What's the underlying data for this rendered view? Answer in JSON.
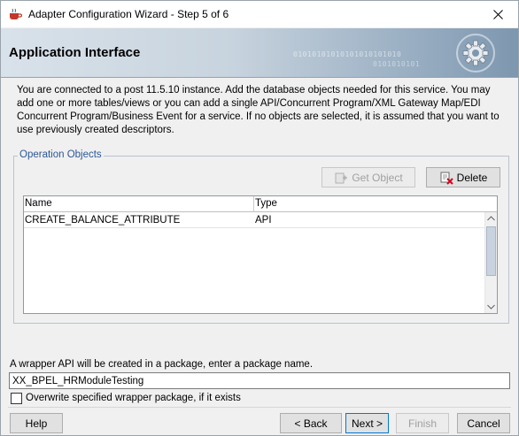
{
  "window": {
    "title": "Adapter Configuration Wizard - Step 5 of 6"
  },
  "header": {
    "title": "Application Interface",
    "binary_line1": "01010101010101010101010",
    "binary_line2": "0101010101"
  },
  "description": "You are connected to a post 11.5.10 instance. Add the database objects needed for this service. You may add one or more tables/views or you can add a single API/Concurrent Program/XML Gateway Map/EDI Concurrent Program/Business Event for a service. If no objects are selected, it is assumed that you want to use previously created descriptors.",
  "operation_objects": {
    "legend": "Operation Objects",
    "get_object_label": "Get Object",
    "delete_label": "Delete",
    "columns": [
      "Name",
      "Type"
    ],
    "rows": [
      {
        "name": "CREATE_BALANCE_ATTRIBUTE",
        "type": "API"
      }
    ]
  },
  "wrapper": {
    "label": "A wrapper API will be created in a package, enter a package name.",
    "package_value": "XX_BPEL_HRModuleTesting",
    "overwrite_label": "Overwrite specified wrapper package, if it exists",
    "overwrite_checked": false
  },
  "footer": {
    "help_label": "Help",
    "back_label": "< Back",
    "next_label": "Next >",
    "finish_label": "Finish",
    "cancel_label": "Cancel"
  },
  "colors": {
    "legend": "#2b5797",
    "header_gradient_end": "#7d97af",
    "focus_border": "#0078d7"
  }
}
